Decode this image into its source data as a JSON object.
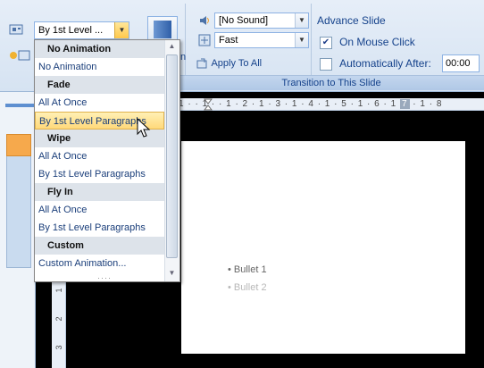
{
  "ribbon": {
    "animation_value": "By 1st Level ...",
    "sound_value": "[No Sound]",
    "speed_value": "Fast",
    "apply_to_all": "Apply To All",
    "partial_label": "n",
    "advance_slide_title": "Advance Slide",
    "on_mouse_click": "On Mouse Click",
    "automatically_after": "Automatically After:",
    "auto_time": "00:00",
    "group_label": "Transition to This Slide"
  },
  "dropdown": {
    "rows": [
      {
        "label": "No Animation",
        "type": "header"
      },
      {
        "label": "No Animation",
        "type": "item"
      },
      {
        "label": "Fade",
        "type": "header"
      },
      {
        "label": "All At Once",
        "type": "item"
      },
      {
        "label": "By 1st Level Paragraphs",
        "type": "selected"
      },
      {
        "label": "Wipe",
        "type": "header"
      },
      {
        "label": "All At Once",
        "type": "item"
      },
      {
        "label": "By 1st Level Paragraphs",
        "type": "item"
      },
      {
        "label": "Fly In",
        "type": "header"
      },
      {
        "label": "All At Once",
        "type": "item"
      },
      {
        "label": "By 1st Level Paragraphs",
        "type": "item"
      },
      {
        "label": "Custom",
        "type": "header"
      },
      {
        "label": "Custom Animation...",
        "type": "item"
      }
    ]
  },
  "ruler": {
    "h_text": "1 · · 1 · · 1 · 2 · 1 · 3 · 1 · 4 · 1 · 5 · 1 · 6 · 1 ",
    "h_highlight": "7",
    "h_tail": " · 1 · 8",
    "v_numbers": [
      "1",
      "2",
      "3"
    ]
  },
  "slide": {
    "bullet1": "• Bullet 1",
    "bullet2": "• Bullet 2"
  },
  "colors": {
    "ribbon_text": "#15428b",
    "selected_bg": "#ffd97a",
    "bullet1": "#666666",
    "bullet2": "#b8b8b8"
  }
}
